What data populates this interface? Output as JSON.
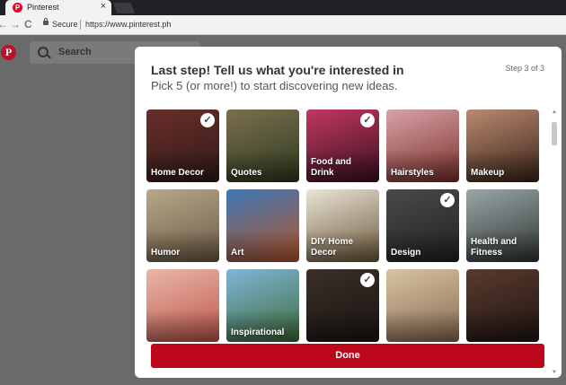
{
  "browser": {
    "tab_title": "Pinterest",
    "tab_favicon": "P",
    "tab_close": "×",
    "secure_label": "Secure",
    "url": "https://www.pinterest.ph",
    "back_icon": "←",
    "forward_icon": "→",
    "reload_icon": "C"
  },
  "page": {
    "logo": "P",
    "search_placeholder": "Search"
  },
  "modal": {
    "title": "Last step! Tell us what you're interested in",
    "subtitle": "Pick 5 (or more!) to start discovering new ideas.",
    "step": "Step 3 of 3",
    "done_label": "Done",
    "check_glyph": "✓",
    "scroll_up": "▲",
    "scroll_down": "▼",
    "topics": [
      {
        "label": "Home Decor",
        "selected": true,
        "colors": [
          "#6b2e2a",
          "#2f1a18"
        ]
      },
      {
        "label": "Quotes",
        "selected": false,
        "colors": [
          "#7b6f4f",
          "#2e3a1f"
        ]
      },
      {
        "label": "Food and Drink",
        "selected": true,
        "colors": [
          "#c2375f",
          "#3a1020"
        ]
      },
      {
        "label": "Hairstyles",
        "selected": false,
        "colors": [
          "#d9a3a8",
          "#7a2f2a"
        ]
      },
      {
        "label": "Makeup",
        "selected": false,
        "colors": [
          "#b98a70",
          "#3b2418"
        ]
      },
      {
        "label": "Humor",
        "selected": false,
        "colors": [
          "#b9a78a",
          "#6c5a45"
        ]
      },
      {
        "label": "Art",
        "selected": false,
        "colors": [
          "#3b78b8",
          "#b8572a"
        ]
      },
      {
        "label": "DIY Home Decor",
        "selected": false,
        "colors": [
          "#e9e4d6",
          "#6f5a3c"
        ]
      },
      {
        "label": "Design",
        "selected": true,
        "colors": [
          "#4a4a4a",
          "#222222"
        ]
      },
      {
        "label": "Health and Fitness",
        "selected": false,
        "colors": [
          "#9ba6a8",
          "#2f3533"
        ]
      },
      {
        "label": "",
        "selected": false,
        "colors": [
          "#e8b7a8",
          "#c0564a"
        ]
      },
      {
        "label": "Inspirational",
        "selected": false,
        "colors": [
          "#7fb6d8",
          "#3f6b3a"
        ]
      },
      {
        "label": "",
        "selected": true,
        "colors": [
          "#3b2f28",
          "#1a1412"
        ]
      },
      {
        "label": "",
        "selected": false,
        "colors": [
          "#d8c3a5",
          "#8a6b4f"
        ]
      },
      {
        "label": "",
        "selected": false,
        "colors": [
          "#5a3a2e",
          "#1f1512"
        ]
      }
    ]
  }
}
